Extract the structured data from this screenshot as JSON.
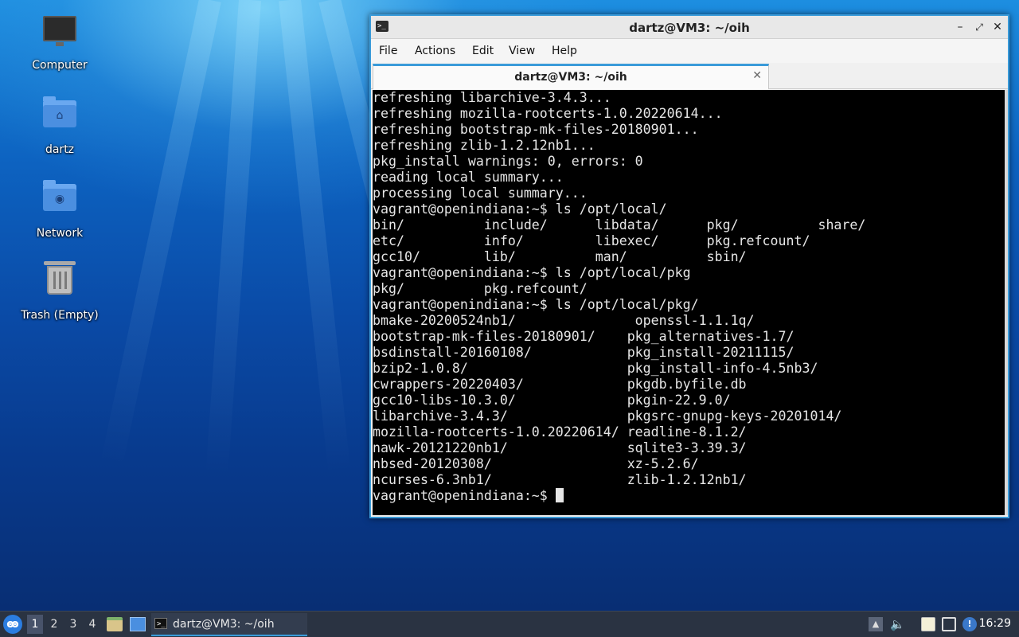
{
  "desktop": {
    "icons": [
      {
        "label": "Computer"
      },
      {
        "label": "dartz"
      },
      {
        "label": "Network"
      },
      {
        "label": "Trash (Empty)"
      }
    ]
  },
  "window": {
    "title": "dartz@VM3: ~/oih",
    "menu": [
      "File",
      "Actions",
      "Edit",
      "View",
      "Help"
    ],
    "tab_label": "dartz@VM3: ~/oih",
    "terminal_lines": [
      "refreshing libarchive-3.4.3...",
      "refreshing mozilla-rootcerts-1.0.20220614...",
      "refreshing bootstrap-mk-files-20180901...",
      "refreshing zlib-1.2.12nb1...",
      "pkg_install warnings: 0, errors: 0",
      "reading local summary...",
      "processing local summary...",
      "vagrant@openindiana:~$ ls /opt/local/",
      "bin/          include/      libdata/      pkg/          share/",
      "etc/          info/         libexec/      pkg.refcount/",
      "gcc10/        lib/          man/          sbin/",
      "vagrant@openindiana:~$ ls /opt/local/pkg",
      "pkg/          pkg.refcount/",
      "vagrant@openindiana:~$ ls /opt/local/pkg/",
      "bmake-20200524nb1/               openssl-1.1.1q/",
      "bootstrap-mk-files-20180901/    pkg_alternatives-1.7/",
      "bsdinstall-20160108/            pkg_install-20211115/",
      "bzip2-1.0.8/                    pkg_install-info-4.5nb3/",
      "cwrappers-20220403/             pkgdb.byfile.db",
      "gcc10-libs-10.3.0/              pkgin-22.9.0/",
      "libarchive-3.4.3/               pkgsrc-gnupg-keys-20201014/",
      "mozilla-rootcerts-1.0.20220614/ readline-8.1.2/",
      "nawk-20121220nb1/               sqlite3-3.39.3/",
      "nbsed-20120308/                 xz-5.2.6/",
      "ncurses-6.3nb1/                 zlib-1.2.12nb1/"
    ],
    "prompt": "vagrant@openindiana:~$ "
  },
  "taskbar": {
    "workspaces": [
      "1",
      "2",
      "3",
      "4"
    ],
    "active_workspace": "1",
    "task_label": "dartz@VM3: ~/oih",
    "clock": "16:29"
  },
  "colors": {
    "accent": "#3a9bd9",
    "terminal_bg": "#000000",
    "terminal_fg": "#e6e6e6",
    "taskbar_bg": "#2a3342"
  }
}
